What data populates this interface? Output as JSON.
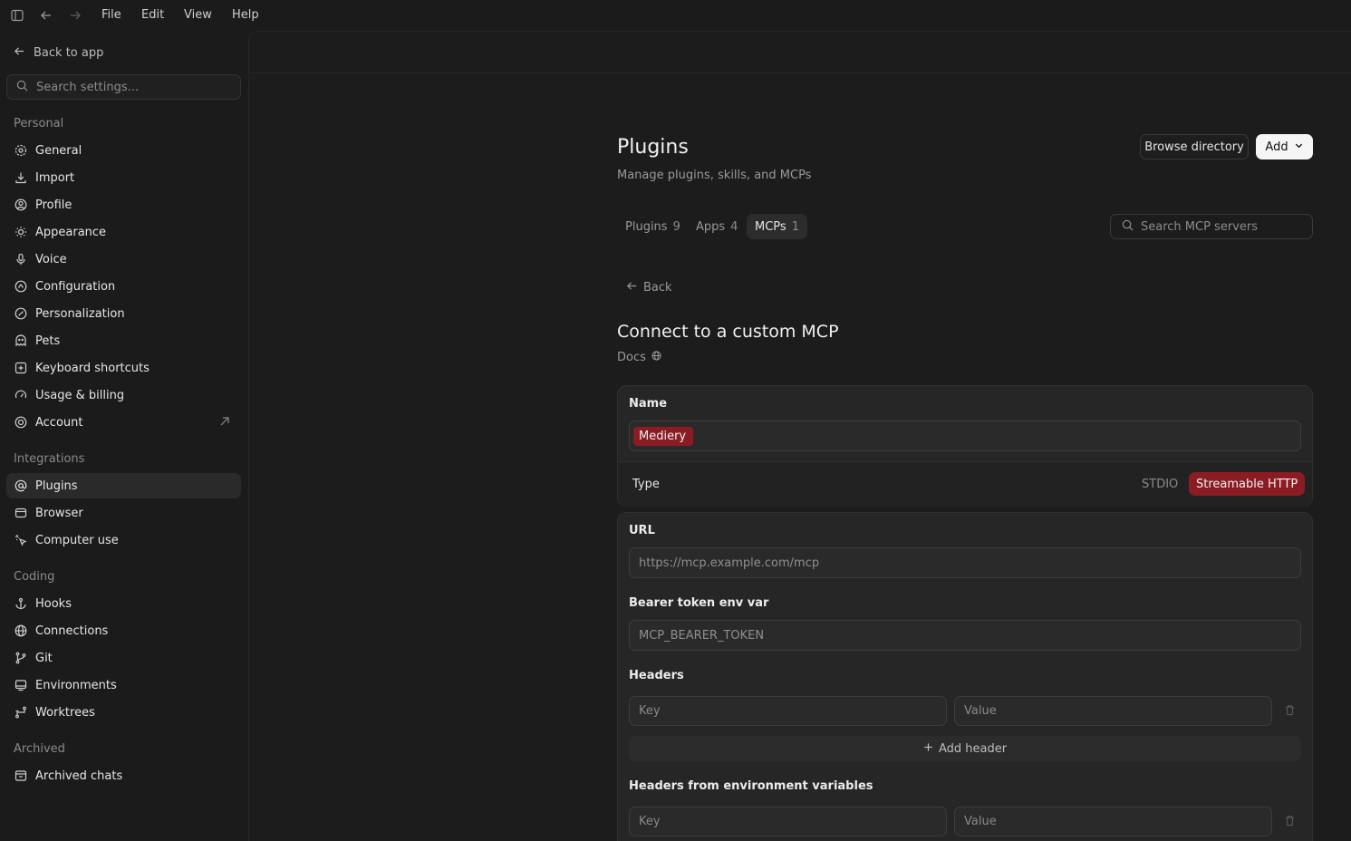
{
  "menubar": {
    "items": [
      "File",
      "Edit",
      "View",
      "Help"
    ]
  },
  "sidebar": {
    "back_label": "Back to app",
    "search_placeholder": "Search settings...",
    "sections": {
      "personal": "Personal",
      "integrations": "Integrations",
      "coding": "Coding",
      "archived": "Archived"
    },
    "items": {
      "general": "General",
      "import": "Import",
      "profile": "Profile",
      "appearance": "Appearance",
      "voice": "Voice",
      "configuration": "Configuration",
      "personalization": "Personalization",
      "pets": "Pets",
      "keyboard": "Keyboard shortcuts",
      "usage": "Usage & billing",
      "account": "Account",
      "plugins": "Plugins",
      "browser": "Browser",
      "computer_use": "Computer use",
      "hooks": "Hooks",
      "connections": "Connections",
      "git": "Git",
      "environments": "Environments",
      "worktrees": "Worktrees",
      "archived_chats": "Archived chats"
    },
    "active": "plugins"
  },
  "header": {
    "title": "Plugins",
    "subtitle": "Manage plugins, skills, and MCPs",
    "browse_label": "Browse directory",
    "add_label": "Add"
  },
  "tabs": [
    {
      "label": "Plugins",
      "count": "9"
    },
    {
      "label": "Apps",
      "count": "4"
    },
    {
      "label": "MCPs",
      "count": "1"
    }
  ],
  "mcp_search_placeholder": "Search MCP servers",
  "form": {
    "back_label": "Back",
    "heading": "Connect to a custom MCP",
    "docs_label": "Docs",
    "name_label": "Name",
    "name_value": "Mediery",
    "type_label": "Type",
    "type_options": [
      "STDIO",
      "Streamable HTTP"
    ],
    "type_selected": "Streamable HTTP",
    "url_label": "URL",
    "url_placeholder": "https://mcp.example.com/mcp",
    "bearer_label": "Bearer token env var",
    "bearer_placeholder": "MCP_BEARER_TOKEN",
    "headers_label": "Headers",
    "key_placeholder": "Key",
    "value_placeholder": "Value",
    "add_header_label": "Add header",
    "env_headers_label": "Headers from environment variables"
  },
  "colors": {
    "accent_highlight": "#8c1c24",
    "background": "#1b1b1b",
    "card": "#262626"
  }
}
